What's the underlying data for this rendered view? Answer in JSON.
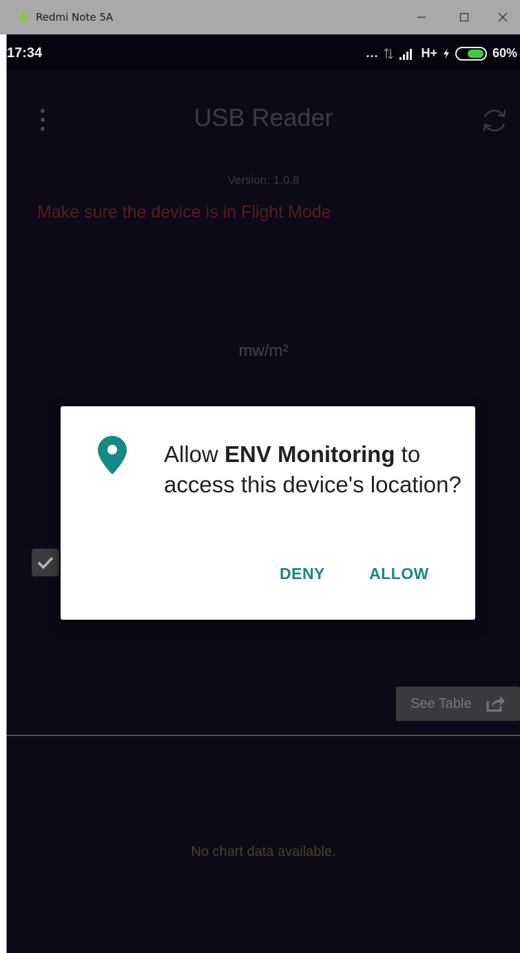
{
  "window": {
    "title": "Redmi Note 5A",
    "controls": {
      "minimize": "minimize-icon",
      "maximize": "maximize-icon",
      "close": "close-icon"
    }
  },
  "status_bar": {
    "time": "17:34",
    "dots": "...",
    "network": "H+",
    "battery_percent": "60%",
    "battery_level": 0.6,
    "battery_color": "#3ccf3c"
  },
  "app": {
    "title": "USB Reader",
    "version": "Version: 1.0.8",
    "warning": "Make sure the device is in Flight Mode",
    "warning_color": "#5a1c1c",
    "unit": "mw/m²",
    "checkbox_checked": true,
    "see_table_label": "See Table",
    "no_chart_message": "No chart data available."
  },
  "dialog": {
    "prefix": "Allow ",
    "app_name": "ENV Monitoring",
    "suffix": " to access this device's location?",
    "deny_label": "DENY",
    "allow_label": "ALLOW",
    "accent_color": "#158a84",
    "icon": "location-pin-icon"
  }
}
